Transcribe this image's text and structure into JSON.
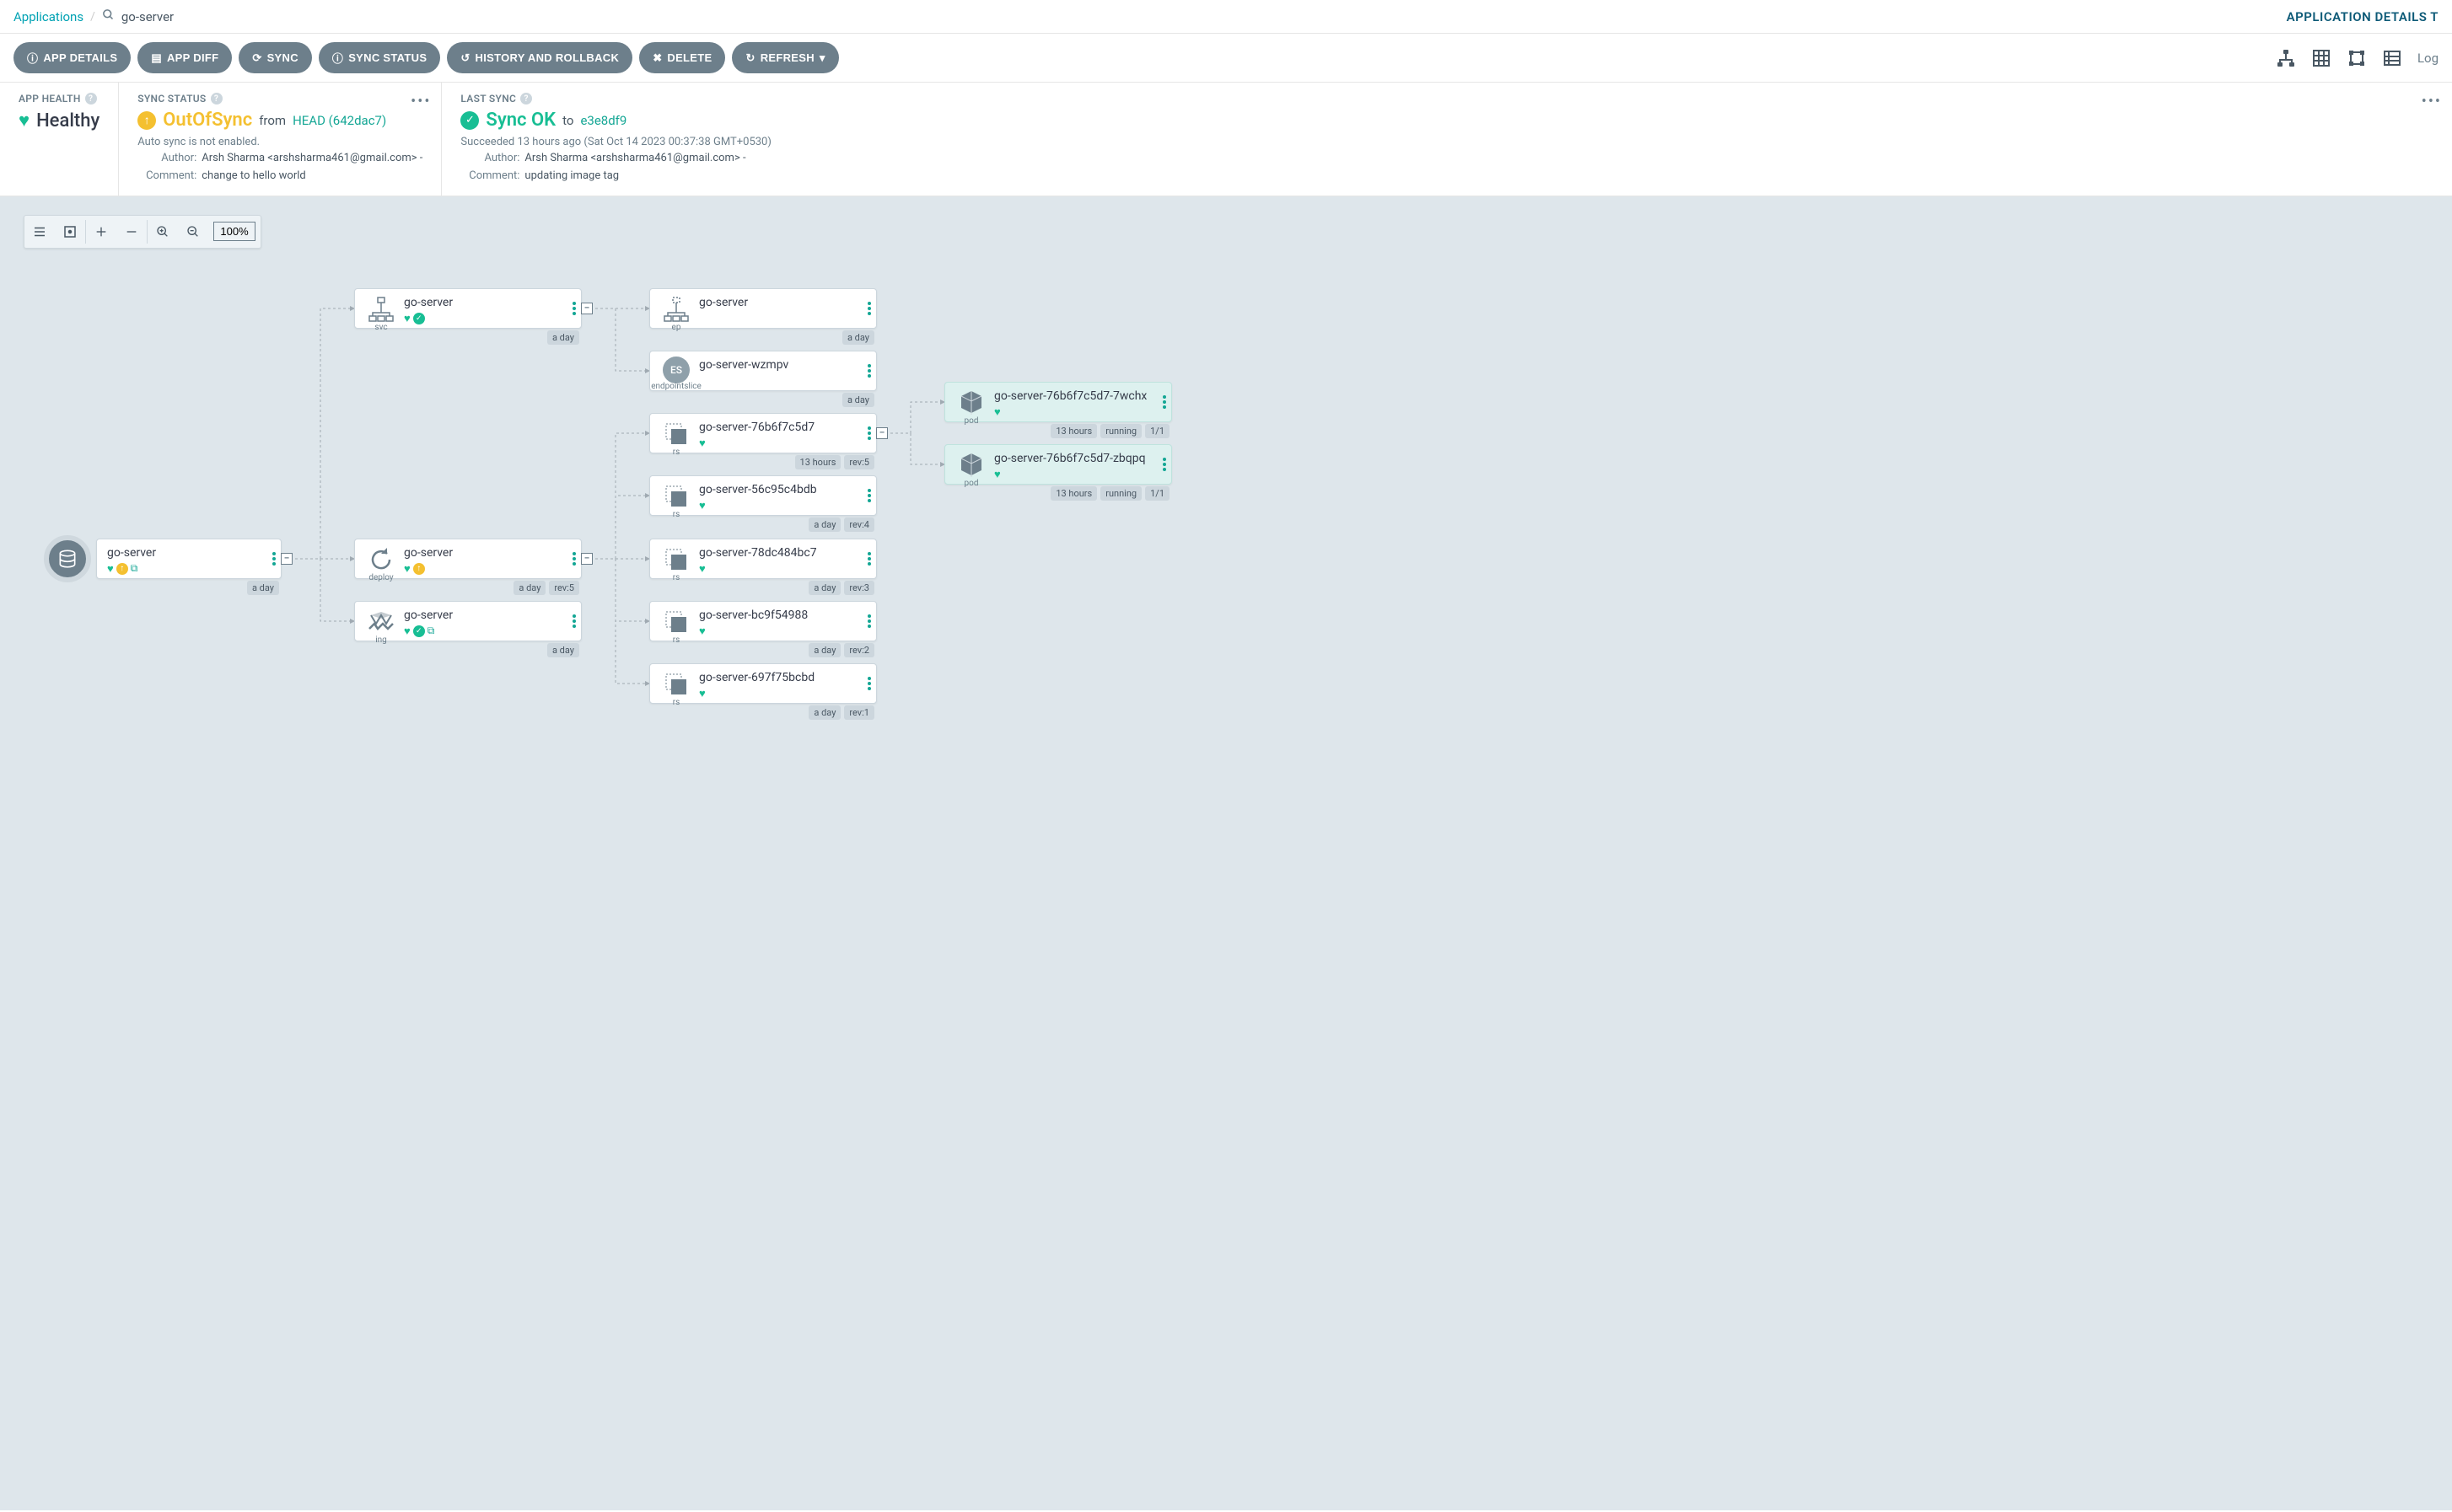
{
  "breadcrumb": {
    "root": "Applications",
    "app": "go-server"
  },
  "topbar_right": "APPLICATION DETAILS T",
  "buttons": {
    "details": "APP DETAILS",
    "diff": "APP DIFF",
    "sync": "SYNC",
    "sync_status": "SYNC STATUS",
    "history": "HISTORY AND ROLLBACK",
    "delete": "DELETE",
    "refresh": "REFRESH"
  },
  "log_label": "Log",
  "health": {
    "title": "APP HEALTH",
    "value": "Healthy"
  },
  "sync_status": {
    "title": "SYNC STATUS",
    "value": "OutOfSync",
    "from": "from",
    "rev": "HEAD (642dac7)",
    "autosync": "Auto sync is not enabled.",
    "author_label": "Author:",
    "author": "Arsh Sharma <arshsharma461@gmail.com> -",
    "comment_label": "Comment:",
    "comment": "change to hello world"
  },
  "last_sync": {
    "title": "LAST SYNC",
    "value": "Sync OK",
    "to": "to",
    "rev": "e3e8df9",
    "succeeded": "Succeeded 13 hours ago (Sat Oct 14 2023 00:37:38 GMT+0530)",
    "author_label": "Author:",
    "author": "Arsh Sharma <arshsharma461@gmail.com> -",
    "comment_label": "Comment:",
    "comment": "updating image tag"
  },
  "zoom": "100%",
  "nodes": {
    "root": {
      "title": "go-server",
      "tag_time": "a day"
    },
    "svc": {
      "kind": "svc",
      "title": "go-server",
      "tag_time": "a day"
    },
    "deploy": {
      "kind": "deploy",
      "title": "go-server",
      "tag_time": "a day",
      "tag_rev": "rev:5"
    },
    "ing": {
      "kind": "ing",
      "title": "go-server",
      "tag_time": "a day"
    },
    "ep": {
      "kind": "ep",
      "title": "go-server",
      "tag_time": "a day"
    },
    "es": {
      "kind": "endpointslice",
      "es_badge": "ES",
      "title": "go-server-wzmpv",
      "tag_time": "a day"
    },
    "rs1": {
      "kind": "rs",
      "title": "go-server-76b6f7c5d7",
      "tag_time": "13 hours",
      "tag_rev": "rev:5"
    },
    "rs2": {
      "kind": "rs",
      "title": "go-server-56c95c4bdb",
      "tag_time": "a day",
      "tag_rev": "rev:4"
    },
    "rs3": {
      "kind": "rs",
      "title": "go-server-78dc484bc7",
      "tag_time": "a day",
      "tag_rev": "rev:3"
    },
    "rs4": {
      "kind": "rs",
      "title": "go-server-bc9f54988",
      "tag_time": "a day",
      "tag_rev": "rev:2"
    },
    "rs5": {
      "kind": "rs",
      "title": "go-server-697f75bcbd",
      "tag_time": "a day",
      "tag_rev": "rev:1"
    },
    "pod1": {
      "kind": "pod",
      "title": "go-server-76b6f7c5d7-7wchx",
      "tag_time": "13 hours",
      "tag_run": "running",
      "tag_ready": "1/1"
    },
    "pod2": {
      "kind": "pod",
      "title": "go-server-76b6f7c5d7-zbqpq",
      "tag_time": "13 hours",
      "tag_run": "running",
      "tag_ready": "1/1"
    }
  }
}
